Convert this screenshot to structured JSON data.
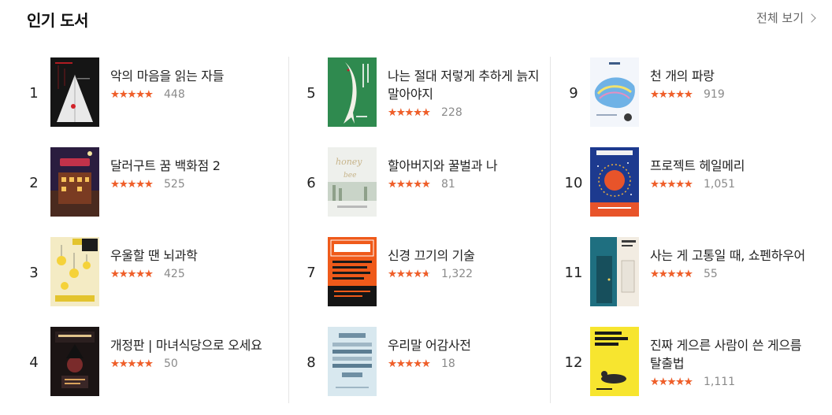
{
  "header": {
    "title": "인기 도서",
    "view_all": "전체 보기"
  },
  "colors": {
    "star": "#f05f2a",
    "star_empty": "#cfcfcf",
    "divider": "#e6e6e6"
  },
  "books": [
    {
      "rank": "1",
      "title": "악의 마음을 읽는 자들",
      "rating": 4.5,
      "count": "448",
      "cover_icon": "book-cover-dark-triangle"
    },
    {
      "rank": "2",
      "title": "달러구트 꿈 백화점 2",
      "rating": 5,
      "count": "525",
      "cover_icon": "book-cover-night-building"
    },
    {
      "rank": "3",
      "title": "우울할 땐 뇌과학",
      "rating": 4.5,
      "count": "425",
      "cover_icon": "book-cover-yellow-lamps"
    },
    {
      "rank": "4",
      "title": "개정판 | 마녀식당으로 오세요",
      "rating": 4.5,
      "count": "50",
      "cover_icon": "book-cover-dark-witch"
    },
    {
      "rank": "5",
      "title": "나는 절대 저렇게 추하게 늙지 말아야지",
      "rating": 4.5,
      "count": "228",
      "cover_icon": "book-cover-green-fish"
    },
    {
      "rank": "6",
      "title": "할아버지와 꿀벌과 나",
      "rating": 5,
      "count": "81",
      "cover_icon": "book-cover-honey-bee"
    },
    {
      "rank": "7",
      "title": "신경 끄기의 기술",
      "rating": 4,
      "count": "1,322",
      "cover_icon": "book-cover-orange-text"
    },
    {
      "rank": "8",
      "title": "우리말 어감사전",
      "rating": 5,
      "count": "18",
      "cover_icon": "book-cover-blue-dictionary"
    },
    {
      "rank": "9",
      "title": "천 개의 파랑",
      "rating": 5,
      "count": "919",
      "cover_icon": "book-cover-blue-waves"
    },
    {
      "rank": "10",
      "title": "프로젝트 헤일메리",
      "rating": 5,
      "count": "1,051",
      "cover_icon": "book-cover-space-sun"
    },
    {
      "rank": "11",
      "title": "사는 게 고통일 때, 쇼펜하우어",
      "rating": 5,
      "count": "55",
      "cover_icon": "book-cover-teal-door"
    },
    {
      "rank": "12",
      "title": "진짜 게으른 사람이 쓴 게으름 탈출법",
      "rating": 4.5,
      "count": "1,111",
      "cover_icon": "book-cover-yellow-lazy"
    }
  ]
}
